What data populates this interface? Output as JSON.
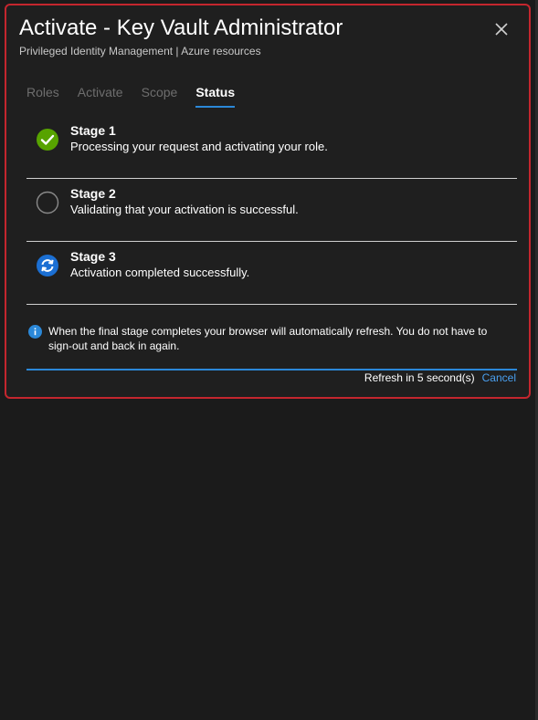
{
  "dialog": {
    "title": "Activate - Key Vault Administrator",
    "subtitle": "Privileged Identity Management | Azure resources",
    "close_icon": "close-icon"
  },
  "tabs": [
    {
      "label": "Roles",
      "active": false
    },
    {
      "label": "Activate",
      "active": false
    },
    {
      "label": "Scope",
      "active": false
    },
    {
      "label": "Status",
      "active": true
    }
  ],
  "stages": [
    {
      "name": "Stage 1",
      "description": "Processing your request and activating your role.",
      "icon": "check-circle-icon",
      "state": "completed"
    },
    {
      "name": "Stage 2",
      "description": "Validating that your activation is successful.",
      "icon": "empty-circle-icon",
      "state": "pending"
    },
    {
      "name": "Stage 3",
      "description": "Activation completed successfully.",
      "icon": "refresh-circle-icon",
      "state": "in-progress"
    }
  ],
  "info": {
    "icon": "info-icon",
    "text": "When the final stage completes your browser will automatically refresh. You do not have to sign-out and back in again."
  },
  "footer": {
    "refresh_text": "Refresh in 5 second(s)",
    "cancel_label": "Cancel"
  },
  "colors": {
    "background": "#1b1b1b",
    "dialog_border": "#c4262e",
    "accent": "#2b88d8",
    "success": "#57a300",
    "link": "#4aa0f0"
  }
}
